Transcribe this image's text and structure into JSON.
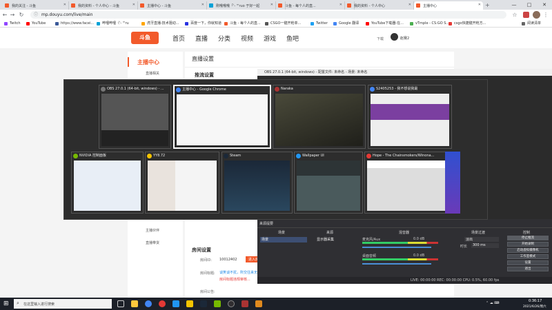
{
  "tabs": [
    {
      "title": "我的关注 - 斗鱼",
      "active": false
    },
    {
      "title": "我的资料 - 个人中心 - 斗鱼",
      "active": false
    },
    {
      "title": "主播中心 - 斗鱼",
      "active": false
    },
    {
      "title": "刚哦哦哦「'- '\"ruo 于好一起",
      "active": false
    },
    {
      "title": "斗鱼 - 每个人的直...",
      "active": false
    },
    {
      "title": "我的资料 - 个人中心",
      "active": false
    },
    {
      "title": "主播中心",
      "active": true
    }
  ],
  "window_controls": {
    "min": "—",
    "max": "□",
    "close": "✕"
  },
  "nav": {
    "back": "←",
    "forward": "→",
    "reload": "↻",
    "url": "mp.douyu.com/live/main",
    "star": "☆"
  },
  "bookmarks": [
    "Twitch",
    "YouTube",
    "https://www.facei...",
    "哔哩哔哩（'- '\"ru",
    "虎牙直播-技术阻动...",
    "百度一下，你就知道",
    "斗鱼 - 每个人的直...",
    "CSGO一键开枪单...",
    "Twitter",
    "Google 翻译",
    "YouTube下载器-在...",
    "vTmple - CS:GO S...",
    "csgo快捷键开枪方...",
    "阅读清单"
  ],
  "douyu": {
    "logo": "斗鱼",
    "logo_sub": "DOUYU.COM",
    "nav": [
      "首页",
      "直播",
      "分类",
      "视频",
      "游戏",
      "鱼吧"
    ],
    "user": "赵赛2",
    "download": "下载",
    "side_title": "主播中心",
    "side_items": [
      "直播相关",
      "主播伙伴",
      "直播带货"
    ],
    "page_title": "直播设置",
    "section1": "推流设置",
    "section2": "房间设置",
    "room_id_label": "房间ID:",
    "room_id": "10012402",
    "room_btn": "进入房间",
    "room_title_label": "房间标题:",
    "room_title_value": "谈笑谈不扰，所交往来无白丁，求关注",
    "room_warn": "房间标题违规审核...",
    "room_notice_label": "房间公告:"
  },
  "switcher": [
    {
      "title": "OBS 27.0.1 (64-bit, windows) - ...",
      "selected": false
    },
    {
      "title": "主播中心 - Google Chrome",
      "selected": true
    },
    {
      "title": "Naraka",
      "selected": false
    },
    {
      "title": "S2405253 - 我不想说我最",
      "selected": false
    },
    {
      "title": "NVIDIA 控制面板",
      "selected": false
    },
    {
      "title": "YY8.72",
      "selected": false
    },
    {
      "title": "Steam",
      "selected": false
    },
    {
      "title": "Wallpaper UI",
      "selected": false
    },
    {
      "title": "Hope - The Chainsmokers/Winona...",
      "selected": false
    }
  ],
  "obs": {
    "title": "OBS 27.0.1 (64-bit, windows) - 配置文件: 未命名 - 场景: 未命名",
    "docks": [
      "来源提要",
      "场景",
      "来源",
      "混音器",
      "场景过渡",
      "控制"
    ],
    "scene": "场景",
    "source": "显示器采集",
    "mixer": [
      {
        "name": "麦克风/Aux",
        "db": "0.0 dB"
      },
      {
        "name": "桌面音频",
        "db": "0.0 dB"
      }
    ],
    "transition_type": "淡出",
    "duration_label": "时长",
    "duration": "300 ms",
    "controls": [
      "停止推流",
      "开始录制",
      "启动虚拟摄像机",
      "工作室模式",
      "设置",
      "退出"
    ],
    "status": "LIVE: 00:00:00  REC: 00:00:00  CPU: 0.5%, 60.00 fps"
  },
  "taskbar": {
    "search": "在这里输入进行搜索",
    "time": "0:36:17",
    "date": "2021/6/26/周六"
  }
}
